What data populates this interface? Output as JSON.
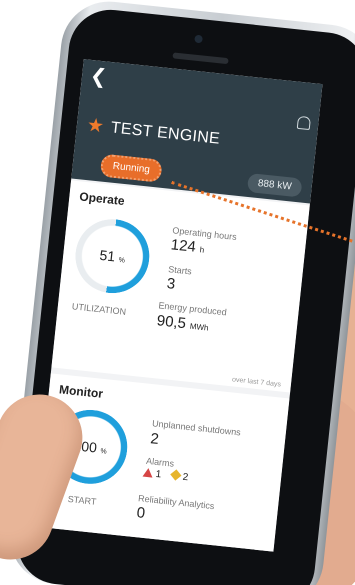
{
  "screen": {
    "title": "TEST ENGINE",
    "status": "Running",
    "power": "888 kW"
  },
  "operate": {
    "section_title": "Operate",
    "utilization": {
      "value": "51",
      "unit": "%",
      "label": "UTILIZATION",
      "fraction": 0.51
    },
    "operating_hours": {
      "label": "Operating hours",
      "value": "124",
      "unit": "h"
    },
    "starts": {
      "label": "Starts",
      "value": "3"
    },
    "energy": {
      "label": "Energy produced",
      "value": "90,5",
      "unit": "MWh"
    },
    "footnote": "over last 7 days"
  },
  "monitor": {
    "section_title": "Monitor",
    "start_reliability": {
      "value": "100",
      "unit": "%",
      "label": "START",
      "fraction": 1.0
    },
    "unplanned_shutdowns": {
      "label": "Unplanned shutdowns",
      "value": "2"
    },
    "alarms": {
      "label": "Alarms",
      "red_count": "1",
      "yellow_count": "2"
    },
    "reliability_analytics": {
      "label": "Reliability Analytics",
      "value": "0"
    }
  },
  "colors": {
    "header": "#2f3f48",
    "accent": "#e86e2a",
    "ring": "#1f9fdc",
    "ring_track": "#e9edf0"
  },
  "icons": {
    "back": "chevron-left-icon",
    "bell": "bell-icon",
    "star": "star-icon",
    "alarm_red": "warning-triangle-icon",
    "alarm_yellow": "diamond-icon"
  }
}
